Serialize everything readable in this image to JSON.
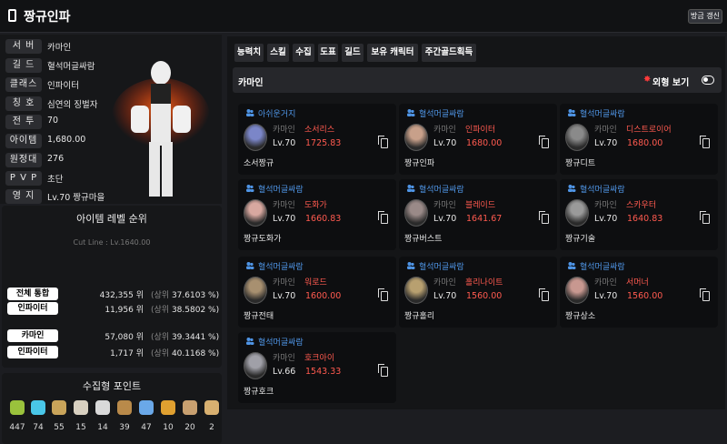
{
  "header": {
    "title": "짱규인파",
    "refresh_label": "방금 갱신"
  },
  "profile": {
    "rows": [
      {
        "label": "서 버",
        "value": "카마인"
      },
      {
        "label": "길 드",
        "value": "혈석머글싸람"
      },
      {
        "label": "클래스",
        "value": "인파이터"
      },
      {
        "label": "칭 호",
        "value": "심연의 징벌자"
      },
      {
        "label": "전 투",
        "value": "70"
      },
      {
        "label": "아이템",
        "value": "1,680.00"
      },
      {
        "label": "원정대",
        "value": "276"
      },
      {
        "label": "P V P",
        "value": "초단"
      },
      {
        "label": "영 지",
        "value": "Lv.70 짱규마을"
      }
    ]
  },
  "ranking": {
    "title": "아이템 레벨 순위",
    "cutline": "Cut Line : Lv.1640.00",
    "rows": [
      {
        "label": "전체 통합",
        "rank": "432,355 위",
        "upper": "(상위",
        "pct": "37.6103 %)"
      },
      {
        "label": "인파이터",
        "rank": "11,956 위",
        "upper": "(상위",
        "pct": "38.5802 %)"
      },
      {
        "label": "카마인",
        "rank": "57,080 위",
        "upper": "(상위",
        "pct": "39.3441 %)"
      },
      {
        "label": "인파이터",
        "rank": "1,717 위",
        "upper": "(상위",
        "pct": "40.1168 %)"
      }
    ]
  },
  "collection": {
    "title": "수집형 포인트",
    "items": [
      {
        "icon": "mokoko-seed-icon",
        "color": "#9ac23c",
        "count": "447"
      },
      {
        "icon": "island-heart-icon",
        "color": "#49c6e8",
        "count": "74"
      },
      {
        "icon": "great-art-icon",
        "color": "#c9a45a",
        "count": "55"
      },
      {
        "icon": "giant-heart-icon",
        "color": "#d8d0c0",
        "count": "15"
      },
      {
        "icon": "ignea-token-icon",
        "color": "#d9d9d9",
        "count": "14"
      },
      {
        "icon": "voyage-log-icon",
        "color": "#b98a4a",
        "count": "39"
      },
      {
        "icon": "sea-bounty-icon",
        "color": "#6aa8e8",
        "count": "47"
      },
      {
        "icon": "world-tree-leaf-icon",
        "color": "#e0a030",
        "count": "10"
      },
      {
        "icon": "omnium-star-icon",
        "color": "#c8a070",
        "count": "20"
      },
      {
        "icon": "orpheus-star-icon",
        "color": "#d8b070",
        "count": "2"
      }
    ]
  },
  "tabs": [
    "능력치",
    "스킬",
    "수집",
    "도표",
    "길드",
    "보유 캐릭터",
    "주간골드획득"
  ],
  "characters_header": {
    "server": "카마인",
    "view_label": "외형 보기"
  },
  "characters": [
    {
      "guild": "아쉬운거지",
      "server": "카마인",
      "cls": "소서리스",
      "lv": "Lv.70",
      "ilvl": "1725.83",
      "name": "소서짱규",
      "accent": "#7b86c8"
    },
    {
      "guild": "혈석머글싸람",
      "server": "카마인",
      "cls": "인파이터",
      "lv": "Lv.70",
      "ilvl": "1680.00",
      "name": "짱규인파",
      "accent": "#c8a08a"
    },
    {
      "guild": "혈석머글싸람",
      "server": "카마인",
      "cls": "디스트로이어",
      "lv": "Lv.70",
      "ilvl": "1680.00",
      "name": "짱규디트",
      "accent": "#8a8a8a"
    },
    {
      "guild": "혈석머글싸람",
      "server": "카마인",
      "cls": "도화가",
      "lv": "Lv.70",
      "ilvl": "1660.83",
      "name": "짱규도화가",
      "accent": "#d8a8a0"
    },
    {
      "guild": "혈석머글싸람",
      "server": "카마인",
      "cls": "블레이드",
      "lv": "Lv.70",
      "ilvl": "1641.67",
      "name": "짱규버스트",
      "accent": "#9a8a88"
    },
    {
      "guild": "혈석머글싸람",
      "server": "카마인",
      "cls": "스카우터",
      "lv": "Lv.70",
      "ilvl": "1640.83",
      "name": "짱규기술",
      "accent": "#9a9a9a"
    },
    {
      "guild": "혈석머글싸람",
      "server": "카마인",
      "cls": "워로드",
      "lv": "Lv.70",
      "ilvl": "1600.00",
      "name": "짱규전태",
      "accent": "#a89070"
    },
    {
      "guild": "혈석머글싸람",
      "server": "카마인",
      "cls": "홀리나이트",
      "lv": "Lv.70",
      "ilvl": "1560.00",
      "name": "짱규홀리",
      "accent": "#b8a070"
    },
    {
      "guild": "혈석머글싸람",
      "server": "카마인",
      "cls": "서머너",
      "lv": "Lv.70",
      "ilvl": "1560.00",
      "name": "짱규상소",
      "accent": "#c89890"
    },
    {
      "guild": "혈석머글싸람",
      "server": "카마인",
      "cls": "호크아이",
      "lv": "Lv.66",
      "ilvl": "1543.33",
      "name": "짱규호크",
      "accent": "#a0a0a8"
    }
  ]
}
